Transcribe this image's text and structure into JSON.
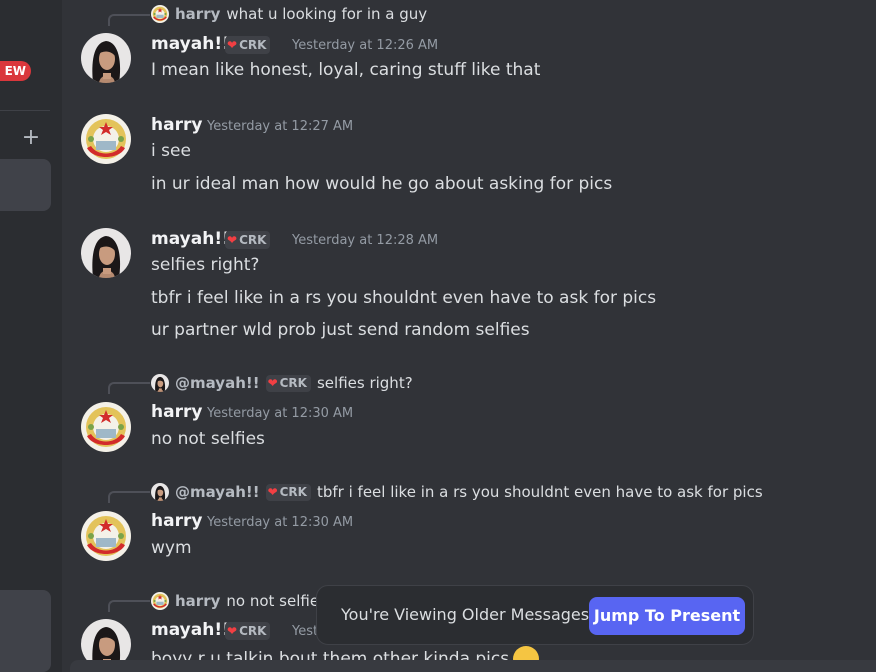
{
  "sidebar": {
    "new_badge": "EW",
    "add_icon": "plus-icon"
  },
  "users": {
    "mayah": {
      "name": "mayah!!",
      "tag": "CRK",
      "mention": "@mayah!!"
    },
    "harry": {
      "name": "harry"
    }
  },
  "messages": [
    {
      "reply_to": {
        "author": "harry",
        "text": "what u looking for in a guy"
      },
      "author": "mayah!!",
      "tag": "CRK",
      "timestamp": "Yesterday at 12:26 AM",
      "lines": [
        "I mean like honest, loyal, caring stuff like that"
      ]
    },
    {
      "author": "harry",
      "timestamp": "Yesterday at 12:27 AM",
      "lines": [
        "i see",
        "in ur ideal man how would he go about asking for pics"
      ]
    },
    {
      "author": "mayah!!",
      "tag": "CRK",
      "timestamp": "Yesterday at 12:28 AM",
      "lines": [
        "selfies right?",
        "tbfr i feel like in a rs you shouldnt even have to ask for pics",
        "ur partner wld prob just send random selfies"
      ]
    },
    {
      "reply_to": {
        "author": "@mayah!!",
        "tag": "CRK",
        "text": "selfies right?"
      },
      "author": "harry",
      "timestamp": "Yesterday at 12:30 AM",
      "lines": [
        "no not selfies"
      ]
    },
    {
      "reply_to": {
        "author": "@mayah!!",
        "tag": "CRK",
        "text": "tbfr i feel like in a rs you shouldnt even have to ask for pics"
      },
      "author": "harry",
      "timestamp": "Yesterday at 12:30 AM",
      "lines": [
        "wym"
      ]
    },
    {
      "reply_to": {
        "author": "harry",
        "text": "no not selfies"
      },
      "author": "mayah!!",
      "tag": "CRK",
      "timestamp": "Yest",
      "lines": [
        "boyy r u talkin bout them other kinda pics"
      ]
    }
  ],
  "jump_bar": {
    "label": "You're Viewing Older Messages",
    "button": "Jump To Present"
  },
  "colors": {
    "accent": "#5865f2",
    "badge": "#da373c",
    "background": "#313338"
  }
}
